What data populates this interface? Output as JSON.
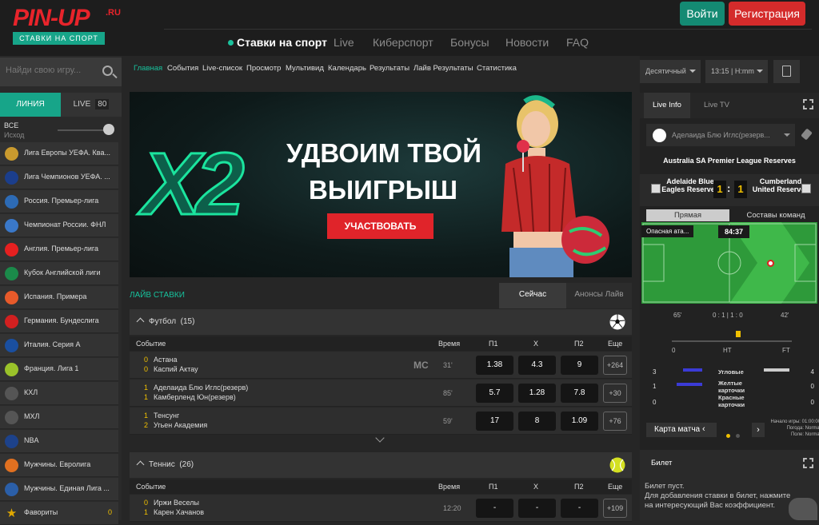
{
  "header": {
    "logo_brand": "PIN-UP",
    "logo_tld": ".RU",
    "logo_sub": "СТАВКИ НА СПОРТ",
    "nav": [
      "Ставки на спорт",
      "Live",
      "Киберспорт",
      "Бонусы",
      "Новости",
      "FAQ"
    ],
    "login": "Войти",
    "register": "Регистрация"
  },
  "left": {
    "search_placeholder": "Найди свою игру...",
    "tab_line": "ЛИНИЯ",
    "tab_live": "LIVE",
    "live_count": "80",
    "all": "ВСЕ",
    "outcome": "Исход",
    "leagues": [
      {
        "name": "Лига Европы УЕФА. Ква...",
        "icon": "trophy-icon",
        "color": "#c99a2e"
      },
      {
        "name": "Лига Чемпионов УЕФА. ...",
        "icon": "ucl-ball-icon",
        "color": "#1b3e8c"
      },
      {
        "name": "Россия. Премьер-лига",
        "icon": "rpl-icon",
        "color": "#2d6bb5"
      },
      {
        "name": "Чемпионат России. ФНЛ",
        "icon": "fnl-icon",
        "color": "#3a78c9"
      },
      {
        "name": "Англия. Премьер-лига",
        "icon": "england-flag-icon",
        "color": "#e62020"
      },
      {
        "name": "Кубок Английской лиги",
        "icon": "cup-icon",
        "color": "#1b8a4a"
      },
      {
        "name": "Испания. Примера",
        "icon": "laliga-icon",
        "color": "#e85a2a"
      },
      {
        "name": "Германия. Бундеслига",
        "icon": "bundesliga-icon",
        "color": "#d22020"
      },
      {
        "name": "Италия. Серия А",
        "icon": "seriea-icon",
        "color": "#1a4fa0"
      },
      {
        "name": "Франция. Лига 1",
        "icon": "ligue1-icon",
        "color": "#9ac22a"
      },
      {
        "name": "КХЛ",
        "icon": "khl-icon",
        "color": "#555555"
      },
      {
        "name": "МХЛ",
        "icon": "mhl-icon",
        "color": "#555555"
      },
      {
        "name": "NBA",
        "icon": "nba-icon",
        "color": "#1d428a"
      },
      {
        "name": "Мужчины. Евролига",
        "icon": "basketball-icon",
        "color": "#e07020"
      },
      {
        "name": "Мужчины. Единая Лига ...",
        "icon": "vtb-icon",
        "color": "#2b5fa8"
      },
      {
        "name": "Фавориты",
        "icon": "star-icon",
        "color": "#e0a800",
        "count": "0"
      }
    ]
  },
  "subnav": [
    "Главная",
    "События",
    "Live-список",
    "Просмотр",
    "Мультивид",
    "Календарь",
    "Результаты",
    "Лайв Результаты",
    "Статистика"
  ],
  "banner": {
    "badge": "X2",
    "line1": "УДВОИМ ТВОЙ",
    "line2": "ВЫИГРЫШ",
    "cta": "УЧАСТВОВАТЬ"
  },
  "live": {
    "label": "ЛАЙВ СТАВКИ",
    "tab_now": "Сейчас",
    "tab_announce": "Анонсы Лайв",
    "columns": [
      "Событие",
      "Время",
      "П1",
      "Х",
      "П2",
      "Еще"
    ],
    "football": {
      "name": "Футбол",
      "count": "(15)",
      "events": [
        {
          "s1": "0",
          "t1": "Астана",
          "s2": "0",
          "t2": "Каспий Актау",
          "tag": "MC",
          "time": "31'",
          "p1": "1.38",
          "x": "4.3",
          "p2": "9",
          "more": "+264"
        },
        {
          "s1": "1",
          "t1": "Аделаида Блю Иглс(резерв)",
          "s2": "1",
          "t2": "Камберленд Юн(резерв)",
          "tag": "",
          "time": "85'",
          "p1": "5.7",
          "x": "1.28",
          "p2": "7.8",
          "more": "+30"
        },
        {
          "s1": "1",
          "t1": "Тенсунг",
          "s2": "2",
          "t2": "Угьен Академия",
          "tag": "",
          "time": "59'",
          "p1": "17",
          "x": "8",
          "p2": "1.09",
          "more": "+76"
        }
      ]
    },
    "tennis": {
      "name": "Теннис",
      "count": "(26)",
      "events": [
        {
          "s1": "0",
          "t1": "Иржи Веселы",
          "s2": "1",
          "t2": "Карен Хачанов",
          "time": "12:20",
          "p1": "-",
          "x": "-",
          "p2": "-",
          "more": "+109"
        }
      ]
    }
  },
  "right": {
    "odds_format": "Десятичный",
    "time_format": "13:15 | H:mm",
    "tab_info": "Live Info",
    "tab_tv": "Live TV",
    "match_select": "Аделаида Блю Иглс(резерв...",
    "league": "Australia SA Premier League Reserves",
    "home": "Adelaide Blue Eagles Reserves",
    "away": "Cumberland United Reserves",
    "score_home": "1",
    "score_away": "1",
    "view_direct": "Прямая",
    "view_lineups": "Составы команд",
    "danger": "Опасная ата...",
    "clock": "84:37",
    "minute_left": "65'",
    "half_scores": "0 : 1 | 1 : 0",
    "minute_right": "42'",
    "tl_start": "0",
    "tl_ht": "HT",
    "tl_ft": "FT",
    "stats": [
      {
        "label": "Угловые",
        "home": "3",
        "away": "4",
        "home_color": "#3b3bd6",
        "away_color": "#cccccc"
      },
      {
        "label": "Желтые карточки",
        "home": "1",
        "away": "0",
        "home_color": "#3b3bd6",
        "away_color": "#cccccc"
      },
      {
        "label": "Красные карточки",
        "home": "0",
        "away": "0",
        "home_color": "#3b3bd6",
        "away_color": "#cccccc"
      }
    ],
    "map_label": "Карта матча",
    "game_start": "Начало игры: 01:00:00",
    "weather": "Погода: Normal",
    "field": "Поле: Normal",
    "ticket_title": "Билет",
    "ticket_empty": "Билет пуст.",
    "ticket_hint": "Для добавления ставки в билет, нажмите на интересующий Вас коэффициент."
  }
}
